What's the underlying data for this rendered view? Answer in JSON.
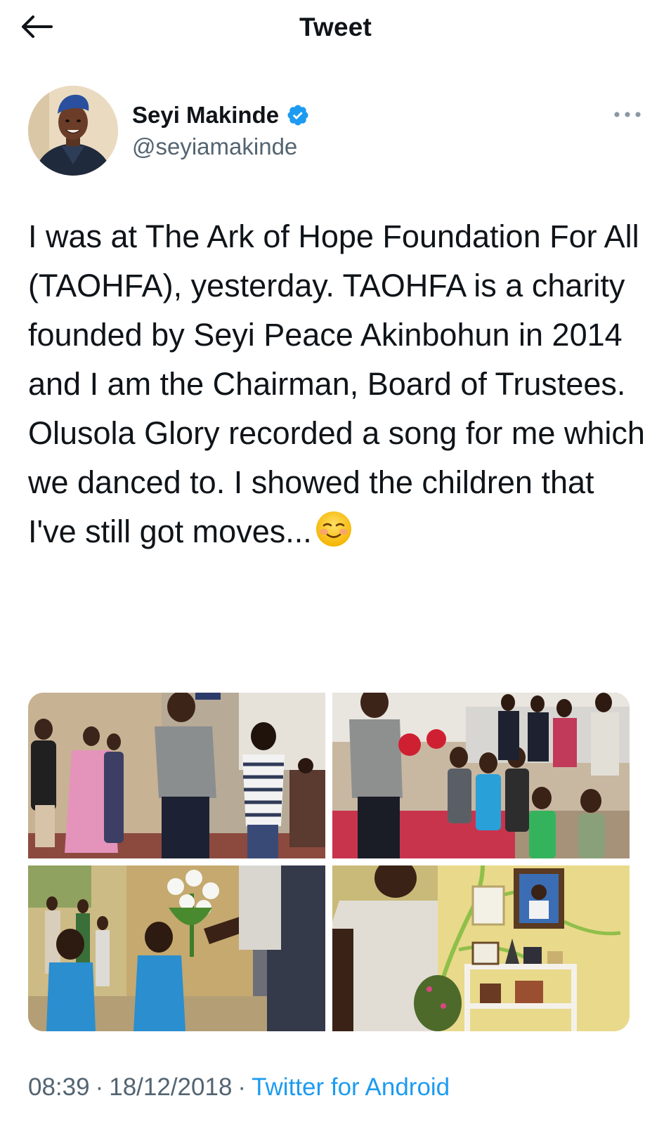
{
  "header": {
    "title": "Tweet",
    "back_icon": "arrow-left-icon"
  },
  "author": {
    "name": "Seyi Makinde",
    "handle": "@seyiamakinde",
    "verified": true,
    "verified_color": "#1d9bf0",
    "more_icon": "more-horizontal-icon"
  },
  "tweet": {
    "text": "I was at The Ark of Hope Foundation For All (TAOHFA), yesterday. TAOHFA is a charity founded by Seyi Peace Akinbohun in 2014 and I am the Chairman, Board of Trustees. Olusola Glory recorded a song for me which we danced to. I showed the children that I've still got moves...",
    "emoji": "smiling-face-emoji"
  },
  "media": [
    {
      "name": "photo-children-greeting"
    },
    {
      "name": "photo-children-dancing"
    },
    {
      "name": "photo-child-flowers"
    },
    {
      "name": "photo-trophy-shelf"
    }
  ],
  "meta": {
    "time": "08:39",
    "date": "18/12/2018",
    "separator": "·",
    "source": "Twitter for Android"
  },
  "colors": {
    "text": "#0f1419",
    "secondary": "#536471",
    "accent": "#1d9bf0"
  }
}
